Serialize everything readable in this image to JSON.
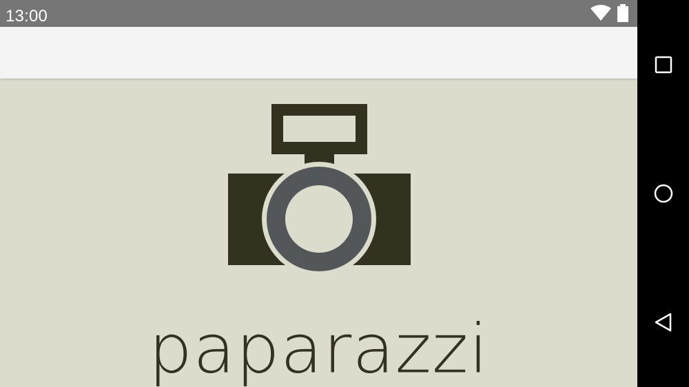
{
  "status_bar": {
    "time": "13:00",
    "icons": [
      "wifi-icon",
      "battery-icon"
    ]
  },
  "app": {
    "name": "paparazzi",
    "logo_icon": "camera-icon"
  },
  "navigation_bar": {
    "buttons": [
      "recents-icon",
      "home-icon",
      "back-icon"
    ]
  },
  "colors": {
    "status_bar": "#767676",
    "app_bar": "#f4f4f4",
    "background": "#dcdccc",
    "camera_body": "#33311f",
    "lens_ring": "#54575a",
    "navigation_bar": "#000000"
  }
}
